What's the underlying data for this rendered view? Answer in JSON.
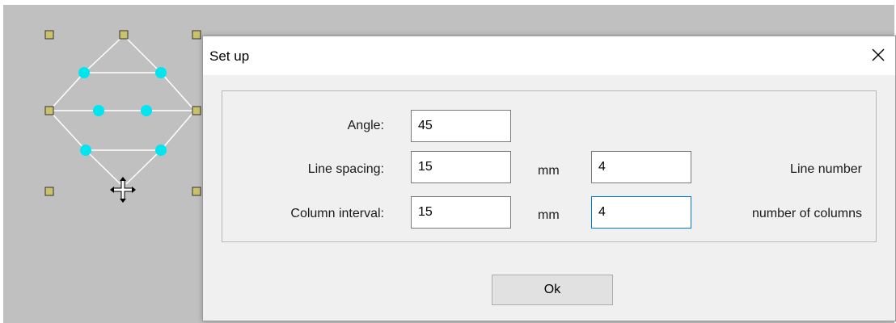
{
  "dialog": {
    "title": "Set up",
    "close_icon": "close-icon"
  },
  "form": {
    "angle_label": "Angle:",
    "angle_value": "45",
    "line_spacing_label": "Line spacing:",
    "line_spacing_value": "15",
    "line_spacing_unit": "mm",
    "line_number_value": "4",
    "line_number_label": "Line number",
    "column_interval_label": "Column interval:",
    "column_interval_value": "15",
    "column_interval_unit": "mm",
    "columns_value": "4",
    "columns_label": "number of columns"
  },
  "buttons": {
    "ok_label": "Ok"
  },
  "colors": {
    "canvas_background": "#c0c0c0",
    "handle_fill": "#c8c26a",
    "point_fill": "#00e5f0",
    "line_color": "#ffffff",
    "focus_border": "#0078d7"
  },
  "icons": {
    "cursor": "crosshair-move-cursor-icon",
    "handle": "selection-handle-icon",
    "point": "control-point-icon"
  }
}
